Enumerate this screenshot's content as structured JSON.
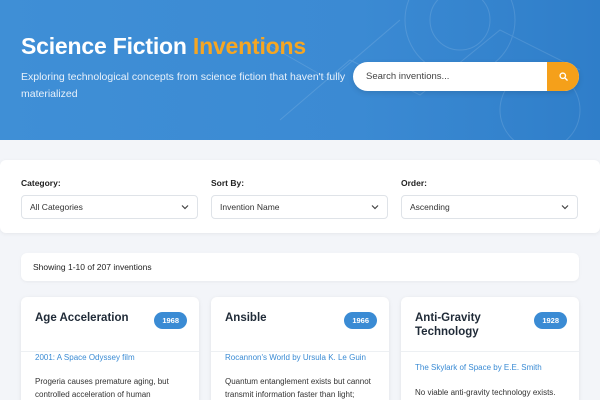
{
  "header": {
    "title_main": "Science Fiction",
    "title_accent": "Inventions",
    "subtitle": "Exploring technological concepts from science fiction that haven't fully materialized",
    "search_placeholder": "Search inventions..."
  },
  "filters": {
    "category_label": "Category:",
    "category_value": "All Categories",
    "sort_label": "Sort By:",
    "sort_value": "Invention Name",
    "order_label": "Order:",
    "order_value": "Ascending"
  },
  "results_text": "Showing 1-10 of 207 inventions",
  "cards": [
    {
      "title": "Age Acceleration",
      "year": "1968",
      "source": "2001: A Space Odyssey film",
      "desc": "Progeria causes premature aging, but controlled acceleration of human"
    },
    {
      "title": "Ansible",
      "year": "1966",
      "source": "Rocannon's World by Ursula K. Le Guin",
      "desc": "Quantum entanglement exists but cannot transmit information faster than light;"
    },
    {
      "title": "Anti-Gravity Technology",
      "year": "1928",
      "source": "The Skylark of Space by E.E. Smith",
      "desc": "No viable anti-gravity technology exists."
    }
  ],
  "colors": {
    "header_blue": "#3b8ad3",
    "accent_orange": "#f5a623",
    "badge_blue": "#3a8bd4",
    "link_blue": "#3a8bd4"
  },
  "icons": {
    "search": "search-icon",
    "dropdown": "chevron-down-icon"
  }
}
